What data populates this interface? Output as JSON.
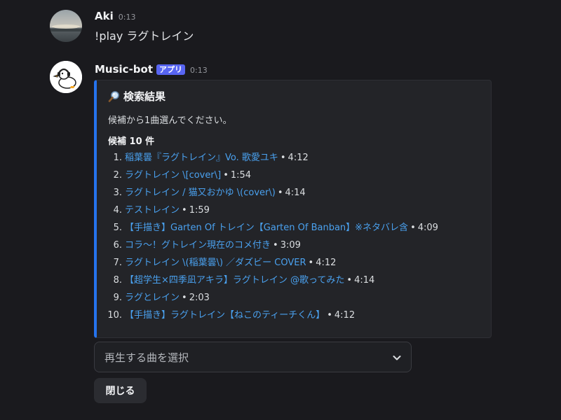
{
  "messages": [
    {
      "author": "Aki",
      "time": "0:13",
      "text": "!play ラグトレイン"
    },
    {
      "author": "Music-bot",
      "badge": "アプリ",
      "time": "0:13"
    }
  ],
  "embed": {
    "title_icon": "magnifier-icon",
    "title": "検索結果",
    "description": "候補から1曲選んでください。",
    "field_name": "候補 10 件",
    "accent_color": "#2573ed",
    "candidates": [
      {
        "num": "1.",
        "title": "稲葉曇『ラグトレイン』Vo. 歌愛ユキ",
        "duration": "4:12"
      },
      {
        "num": "2.",
        "title": "ラグトレイン \\[cover\\]",
        "duration": "1:54"
      },
      {
        "num": "3.",
        "title": "ラグトレイン / 猫又おかゆ \\(cover\\)",
        "duration": "4:14"
      },
      {
        "num": "4.",
        "title": "テストレイン",
        "duration": "1:59"
      },
      {
        "num": "5.",
        "title": "【手描き】Garten Of トレイン【Garten Of Banban】※ネタバレ含",
        "duration": "4:09"
      },
      {
        "num": "6.",
        "title": "コラ～！グトレイン現在のコメ付き",
        "duration": "3:09"
      },
      {
        "num": "7.",
        "title": "ラグトレイン \\(稲葉曇\\) ／ダズビー COVER",
        "duration": "4:12"
      },
      {
        "num": "8.",
        "title": "【超学生×四季凪アキラ】ラグトレイン @歌ってみた",
        "duration": "4:14"
      },
      {
        "num": "9.",
        "title": "ラグとレイン",
        "duration": "2:03"
      },
      {
        "num": "10.",
        "title": "【手描き】ラグトレイン【ねこのティーチくん】",
        "duration": "4:12"
      }
    ],
    "separator": "•"
  },
  "select": {
    "placeholder": "再生する曲を選択",
    "icon": "chevron-down-icon"
  },
  "close_button": {
    "label": "閉じる"
  }
}
